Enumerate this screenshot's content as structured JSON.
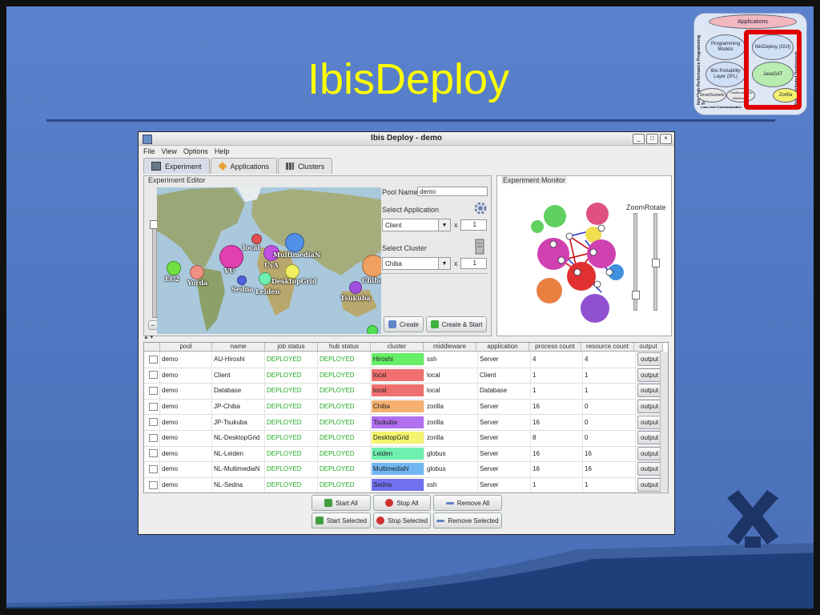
{
  "slide": {
    "title": "IbisDeploy"
  },
  "architecture": {
    "top_label": "Applications",
    "left_vertical": "Ibis High-Performance Programming System",
    "right_vertical": "Ibis Distributed Deployment",
    "items": [
      "Programming Models",
      "IbisDeploy (GUI)",
      "Ibis Portability Layer (IPL)",
      "JavaGAT",
      "SmartSockets",
      "Traditional Grid Middleware",
      "Zorilla",
      "Low-Level Communication"
    ]
  },
  "window": {
    "title": "Ibis Deploy - demo",
    "buttons": [
      "_",
      "□",
      "×"
    ],
    "menu": [
      "File",
      "View",
      "Options",
      "Help"
    ],
    "tabs": [
      {
        "label": "Experiment",
        "icon": "monitor-icon"
      },
      {
        "label": "Applications",
        "icon": "diamond-icon"
      },
      {
        "label": "Clusters",
        "icon": "servers-icon"
      }
    ]
  },
  "editor": {
    "panel_label": "Experiment Editor",
    "pool_name_label": "Pool Name:",
    "pool_name_value": "demo",
    "select_application_label": "Select Application",
    "application_value": "Client",
    "application_count": "1",
    "select_cluster_label": "Select Cluster",
    "cluster_value": "Chiba",
    "cluster_count": "1",
    "times": "x",
    "create_label": "Create",
    "create_start_label": "Create & Start",
    "zoom_minus": "−",
    "zoom_plus": "+",
    "map_cities": [
      "local",
      "MultimediaN",
      "VU",
      "UvA",
      "EC2",
      "Yorda",
      "DesktopGrid",
      "Chiba",
      "Sedna",
      "Leiden",
      "Tsukuba"
    ]
  },
  "monitor": {
    "panel_label": "Experiment Monitor",
    "zoom_label": "Zoom",
    "rotate_label": "Rotate"
  },
  "table": {
    "columns": [
      "",
      "pool",
      "name",
      "job status",
      "hub status",
      "cluster",
      "middleware",
      "application",
      "process count",
      "resource count",
      "output"
    ],
    "rows": [
      {
        "pool": "demo",
        "name": "AU-Hiroshi",
        "job": "DEPLOYED",
        "hub": "DEPLOYED",
        "cluster": "Hiroshi",
        "color": "#66ee66",
        "mw": "ssh",
        "app": "Server",
        "pc": "4",
        "rc": "4",
        "out": "output"
      },
      {
        "pool": "demo",
        "name": "Client",
        "job": "DEPLOYED",
        "hub": "DEPLOYED",
        "cluster": "local",
        "color": "#f07070",
        "mw": "local",
        "app": "Client",
        "pc": "1",
        "rc": "1",
        "out": "output"
      },
      {
        "pool": "demo",
        "name": "Database",
        "job": "DEPLOYED",
        "hub": "DEPLOYED",
        "cluster": "local",
        "color": "#f07070",
        "mw": "local",
        "app": "Database",
        "pc": "1",
        "rc": "1",
        "out": "output"
      },
      {
        "pool": "demo",
        "name": "JP-Chiba",
        "job": "DEPLOYED",
        "hub": "DEPLOYED",
        "cluster": "Chiba",
        "color": "#f6b070",
        "mw": "zorilla",
        "app": "Server",
        "pc": "16",
        "rc": "0",
        "out": "output"
      },
      {
        "pool": "demo",
        "name": "JP-Tsukuba",
        "job": "DEPLOYED",
        "hub": "DEPLOYED",
        "cluster": "Tsukuba",
        "color": "#b070f0",
        "mw": "zorilla",
        "app": "Server",
        "pc": "16",
        "rc": "0",
        "out": "output"
      },
      {
        "pool": "demo",
        "name": "NL-DesktopGrid",
        "job": "DEPLOYED",
        "hub": "DEPLOYED",
        "cluster": "DesktopGrid",
        "color": "#f4f470",
        "mw": "zorilla",
        "app": "Server",
        "pc": "8",
        "rc": "0",
        "out": "output"
      },
      {
        "pool": "demo",
        "name": "NL-Leiden",
        "job": "DEPLOYED",
        "hub": "DEPLOYED",
        "cluster": "Leiden",
        "color": "#70f0b0",
        "mw": "globus",
        "app": "Server",
        "pc": "16",
        "rc": "16",
        "out": "output"
      },
      {
        "pool": "demo",
        "name": "NL-MultimediaN",
        "job": "DEPLOYED",
        "hub": "DEPLOYED",
        "cluster": "MultimediaN",
        "color": "#70b8f4",
        "mw": "globus",
        "app": "Server",
        "pc": "16",
        "rc": "16",
        "out": "output"
      },
      {
        "pool": "demo",
        "name": "NL-Sedna",
        "job": "DEPLOYED",
        "hub": "DEPLOYED",
        "cluster": "Sedna",
        "color": "#7070f0",
        "mw": "ssh",
        "app": "Server",
        "pc": "1",
        "rc": "1",
        "out": "output"
      }
    ]
  },
  "actions": {
    "start_all": "Start All",
    "stop_all": "Stop All",
    "remove_all": "Remove All",
    "start_selected": "Start Selected",
    "stop_selected": "Stop Selected",
    "remove_selected": "Remove Selected"
  }
}
